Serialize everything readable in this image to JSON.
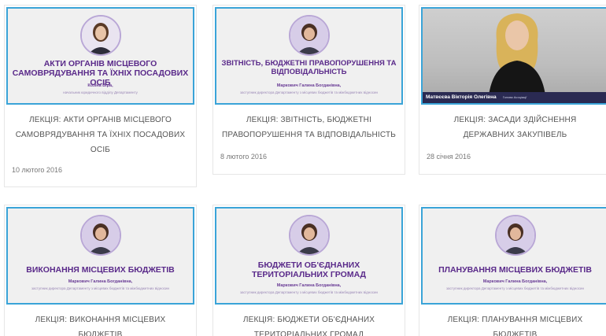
{
  "cards": [
    {
      "thumb_title": "АКТИ ОРГАНІВ МІСЦЕВОГО САМОВРЯДУВАННЯ ТА ЇХНІХ ПОСАДОВИХ ОСІБ",
      "thumb_author": "Козіна Віра,",
      "thumb_sub": "начальник юридичного відділу Департаменту",
      "title": "ЛЕКЦІЯ: АКТИ ОРГАНІВ МІСЦЕВОГО САМОВРЯДУВАННЯ ТА ЇХНІХ ПОСАДОВИХ ОСІБ",
      "date": "10 лютого 2016"
    },
    {
      "thumb_title": "ЗВІТНІСТЬ, БЮДЖЕТНІ ПРАВОПОРУШЕННЯ ТА ВІДПОВІДАЛЬНІСТЬ",
      "thumb_author": "Маркович Галина Богданівна,",
      "thumb_sub": "заступник директора Департаменту з місцевих бюджетів та міжбюджетних відносин",
      "title": "ЛЕКЦІЯ: ЗВІТНІСТЬ, БЮДЖЕТНІ ПРАВОПОРУШЕННЯ ТА ВІДПОВІДАЛЬНІСТЬ",
      "date": "8 лютого 2016"
    },
    {
      "lower_third_name": "Матвєєва Вікторія Олегівна",
      "lower_third_sub": "Голова Асоціації",
      "title": "ЛЕКЦІЯ: ЗАСАДИ ЗДІЙСНЕННЯ ДЕРЖАВНИХ ЗАКУПІВЕЛЬ",
      "date": "28 січня 2016"
    },
    {
      "thumb_title": "ВИКОНАННЯ МІСЦЕВИХ БЮДЖЕТІВ",
      "thumb_author": "Маркович Галина Богданівна,",
      "thumb_sub": "заступник директора Департаменту з місцевих бюджетів та міжбюджетних відносин",
      "title": "ЛЕКЦІЯ: ВИКОНАННЯ МІСЦЕВИХ БЮДЖЕТІВ"
    },
    {
      "thumb_title": "БЮДЖЕТИ ОБ'ЄДНАНИХ ТЕРИТОРІАЛЬНИХ ГРОМАД",
      "thumb_author": "Маркович Галина Богданівна,",
      "thumb_sub": "заступник директора Департаменту з місцевих бюджетів та міжбюджетних відносин",
      "title": "ЛЕКЦІЯ: БЮДЖЕТИ ОБ'ЄДНАНИХ ТЕРИТОРІАЛЬНИХ ГРОМАД"
    },
    {
      "thumb_title": "ПЛАНУВАННЯ МІСЦЕВИХ БЮДЖЕТІВ",
      "thumb_author": "Маркович Галина Богданівна,",
      "thumb_sub": "заступник директора Департаменту з місцевих бюджетів та міжбюджетних відносин",
      "title": "ЛЕКЦІЯ: ПЛАНУВАННЯ МІСЦЕВИХ БЮДЖЕТІВ"
    }
  ],
  "colors": {
    "thumb_border": "#3aa4d8",
    "thumb_title": "#5a2a8a",
    "card_text": "#555555",
    "date_text": "#777777"
  }
}
